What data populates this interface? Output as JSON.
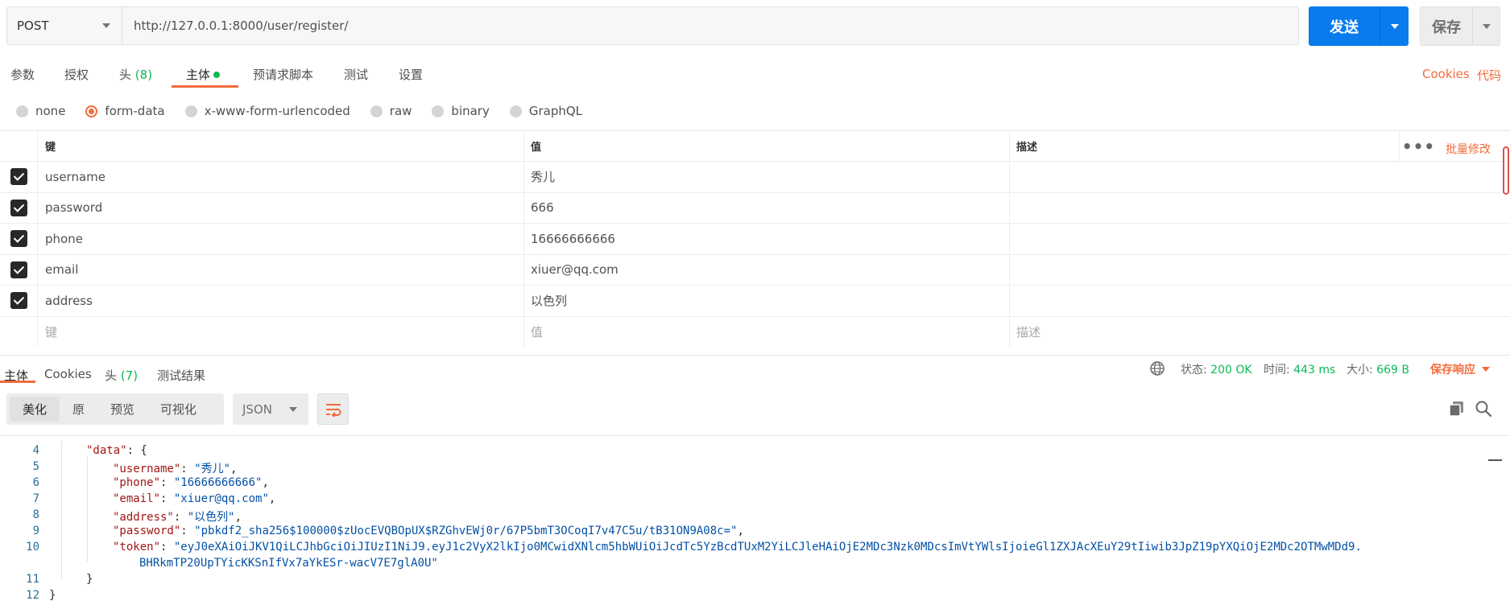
{
  "request": {
    "method": "POST",
    "url": "http://127.0.0.1:8000/user/register/",
    "send_label": "发送",
    "save_label": "保存"
  },
  "request_tabs": {
    "params": "参数",
    "auth": "授权",
    "headers": "头",
    "headers_count": "(8)",
    "body": "主体",
    "prerequest": "预请求脚本",
    "tests": "测试",
    "settings": "设置",
    "cookies": "Cookies",
    "code": "代码"
  },
  "body_types": [
    "none",
    "form-data",
    "x-www-form-urlencoded",
    "raw",
    "binary",
    "GraphQL"
  ],
  "body_type_selected": "form-data",
  "kv_table": {
    "headers": {
      "key": "键",
      "value": "值",
      "description": "描述"
    },
    "bulk_edit": "批量修改",
    "rows": [
      {
        "key": "username",
        "value": "秀儿",
        "checked": true
      },
      {
        "key": "password",
        "value": "666",
        "checked": true
      },
      {
        "key": "phone",
        "value": "16666666666",
        "checked": true
      },
      {
        "key": "email",
        "value": "xiuer@qq.com",
        "checked": true
      },
      {
        "key": "address",
        "value": "以色列",
        "checked": true
      }
    ],
    "placeholders": {
      "key": "键",
      "value": "值",
      "description": "描述"
    }
  },
  "response": {
    "tabs": {
      "body": "主体",
      "cookies": "Cookies",
      "headers": "头",
      "headers_count": "(7)",
      "test_results": "测试结果"
    },
    "status_label": "状态:",
    "status_value": "200 OK",
    "time_label": "时间:",
    "time_value": "443 ms",
    "size_label": "大小:",
    "size_value": "669 B",
    "save_response": "保存响应",
    "views": {
      "pretty": "美化",
      "raw": "原",
      "preview": "预览",
      "visualize": "可视化"
    },
    "format": "JSON"
  },
  "code_lines": [
    {
      "n": "4",
      "indent": 1,
      "html": "<span class='k'>\"data\"</span><span class='p'>: {</span>"
    },
    {
      "n": "5",
      "indent": 2,
      "html": "<span class='k'>\"username\"</span><span class='p'>: </span><span class='s'>\"秀儿\"</span><span class='p'>,</span>"
    },
    {
      "n": "6",
      "indent": 2,
      "html": "<span class='k'>\"phone\"</span><span class='p'>: </span><span class='s'>\"16666666666\"</span><span class='p'>,</span>"
    },
    {
      "n": "7",
      "indent": 2,
      "html": "<span class='k'>\"email\"</span><span class='p'>: </span><span class='s'>\"xiuer@qq.com\"</span><span class='p'>,</span>"
    },
    {
      "n": "8",
      "indent": 2,
      "html": "<span class='k'>\"address\"</span><span class='p'>: </span><span class='s'>\"以色列\"</span><span class='p'>,</span>"
    },
    {
      "n": "9",
      "indent": 2,
      "html": "<span class='k'>\"password\"</span><span class='p'>: </span><span class='s'>\"pbkdf2_sha256$100000$zUocEVQBOpUX$RZGhvEWj0r/67P5bmT3OCoqI7v47C5u/tB31ON9A08c=\"</span><span class='p'>,</span>"
    },
    {
      "n": "10",
      "indent": 2,
      "html": "<span class='k'>\"token\"</span><span class='p'>: </span><span class='s'>\"eyJ0eXAiOiJKV1QiLCJhbGciOiJIUzI1NiJ9.eyJ1c2VyX2lkIjo0MCwidXNlcm5hbWUiOiJcdTc5YzBcdTUxM2YiLCJleHAiOjE2MDc3Nzk0MDcsImVtYWlsIjoieGl1ZXJAcXEuY29tIiwib3JpZ19pYXQiOjE2MDc2OTMwMDd9.</span>"
    },
    {
      "n": "",
      "indent": 3,
      "html": "<span class='s'>BHRkmTP20UpTYicKKSnIfVx7aYkESr-wacV7E7glA0U\"</span>"
    },
    {
      "n": "11",
      "indent": 1,
      "html": "<span class='p'>}</span>"
    },
    {
      "n": "12",
      "indent": 0,
      "html": "<span class='p'>}</span>"
    }
  ]
}
